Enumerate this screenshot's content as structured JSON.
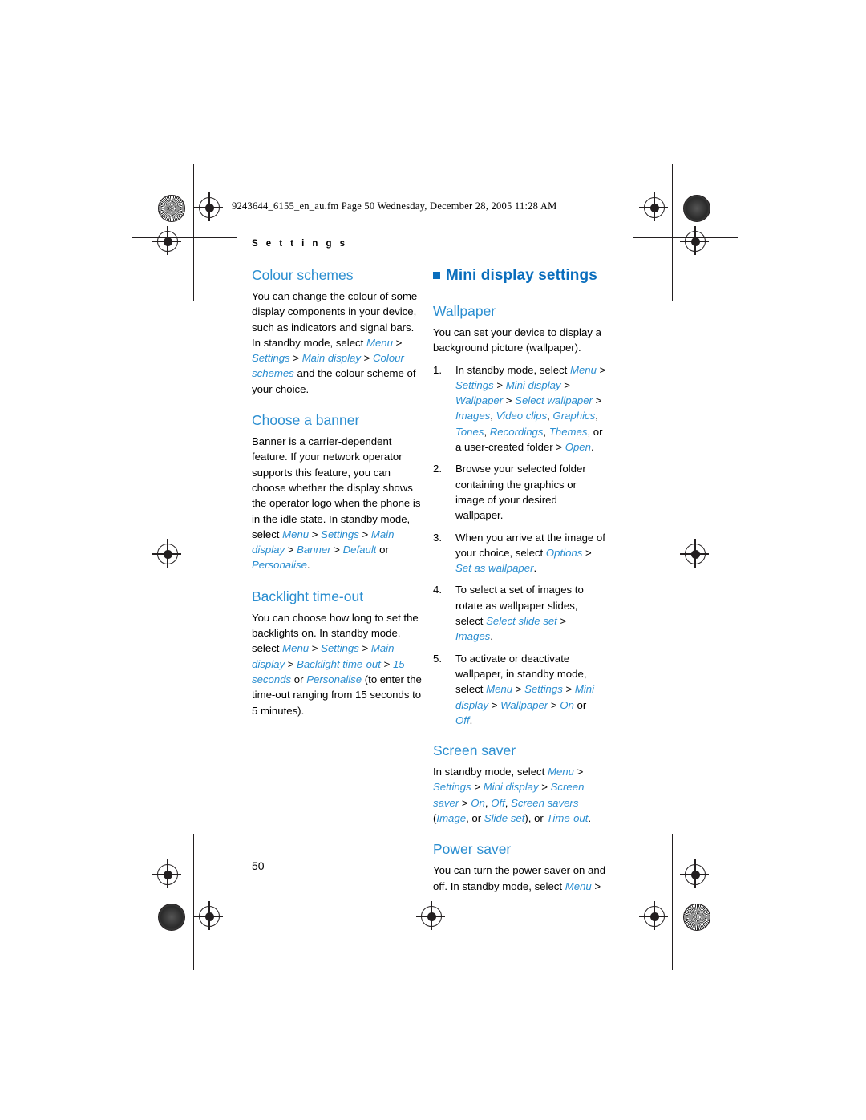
{
  "print_marks": {
    "file_header": "9243644_6155_en_au.fm  Page 50  Wednesday, December 28, 2005  11:28 AM"
  },
  "page": {
    "running_head": "S e t t i n g s",
    "page_number": "50",
    "accent_heading": "#0a6ebd",
    "accent_subheading": "#2b8ed0"
  },
  "left_column": {
    "colour_schemes": {
      "title": "Colour schemes",
      "p1": "You can change the colour of some display components in your device, such as indicators and signal bars. In standby mode, select ",
      "p1_path1": "Menu",
      "p1_sep1": " > ",
      "p1_path2": "Settings",
      "p1_sep2": " > ",
      "p1_path3": "Main display",
      "p1_sep3": " > ",
      "p1_path4": "Colour schemes",
      "p1_tail": " and the colour scheme of your choice."
    },
    "choose_a_banner": {
      "title": "Choose a banner",
      "p1": "Banner is a carrier-dependent feature. If your network operator supports this feature, you can choose whether the display shows the operator logo when the phone is in the idle state. In standby mode, select ",
      "p1_path1": "Menu",
      "p1_sep1": " > ",
      "p1_path2": "Settings",
      "p1_sep2": " > ",
      "p1_path3": "Main display",
      "p1_sep3": " > ",
      "p1_path4": "Banner",
      "p1_sep4": " > ",
      "p1_path5": "Default",
      "p1_or": " or ",
      "p1_path6": "Personalise",
      "p1_tail": "."
    },
    "backlight_time_out": {
      "title": "Backlight time-out",
      "p1": "You can choose how long to set the backlights on. In standby mode, select ",
      "p1_path1": "Menu",
      "p1_sep1": " > ",
      "p1_path2": "Settings",
      "p1_sep2": " > ",
      "p1_path3": "Main display",
      "p1_sep3": " > ",
      "p1_path4": "Backlight time-out",
      "p1_sep4": " > ",
      "p1_path5": "15 seconds",
      "p1_or": " or ",
      "p1_path6": "Personalise",
      "p1_tail": " (to enter the time-out ranging from 15 seconds to 5 minutes)."
    }
  },
  "right_column": {
    "mini_display_settings": {
      "title": "Mini display settings"
    },
    "wallpaper": {
      "title": "Wallpaper",
      "intro": "You can set your device to display a background picture (wallpaper).",
      "steps": [
        {
          "num": "1.",
          "lead": "In standby mode, select ",
          "path1": "Menu",
          "sep1": " > ",
          "path2": "Settings",
          "sep2": " > ",
          "path3": "Mini display",
          "sep3": " > ",
          "path4": "Wallpaper",
          "sep4": " > ",
          "path5": "Select wallpaper",
          "sep5": " > ",
          "path6": "Images",
          "c1": ", ",
          "path7": "Video clips",
          "c2": ", ",
          "path8": "Graphics",
          "c3": ", ",
          "path9": "Tones",
          "c4": ", ",
          "path10": "Recordings",
          "c5": ", ",
          "path11": "Themes",
          "tail1": ", or a user-created folder > ",
          "path12": "Open",
          "tail2": "."
        },
        {
          "num": "2.",
          "text": "Browse your selected folder containing the graphics or image of your desired wallpaper."
        },
        {
          "num": "3.",
          "lead": "When you arrive at the image of your choice, select ",
          "path1": "Options",
          "sep1": " > ",
          "path2": "Set as wallpaper",
          "tail": "."
        },
        {
          "num": "4.",
          "lead": "To select a set of images to rotate as wallpaper slides, select ",
          "path1": "Select slide set",
          "sep1": " > ",
          "path2": "Images",
          "tail": "."
        },
        {
          "num": "5.",
          "lead": "To activate or deactivate wallpaper, in standby mode, select ",
          "path1": "Menu",
          "sep1": " > ",
          "path2": "Settings",
          "sep2": " > ",
          "path3": "Mini display",
          "sep3": " > ",
          "path4": "Wallpaper",
          "sep4": " > ",
          "path5": "On",
          "or": " or ",
          "path6": "Off",
          "tail": "."
        }
      ]
    },
    "screen_saver": {
      "title": "Screen saver",
      "lead": "In standby mode, select ",
      "path1": "Menu",
      "sep1": " > ",
      "path2": "Settings",
      "sep2": " > ",
      "path3": "Mini display",
      "sep3": " > ",
      "path4": "Screen saver",
      "sep4": " > ",
      "path5": "On",
      "c1": ", ",
      "path6": "Off",
      "c2": ", ",
      "path7": "Screen savers",
      "tail1": " (",
      "path8": "Image",
      "c3": ", or ",
      "path9": "Slide set",
      "tail2": "), or ",
      "path10": "Time-out",
      "tail3": "."
    },
    "power_saver": {
      "title": "Power saver",
      "lead": "You can turn the power saver on and off. In standby mode, select ",
      "path1": "Menu",
      "tail": " >"
    }
  }
}
